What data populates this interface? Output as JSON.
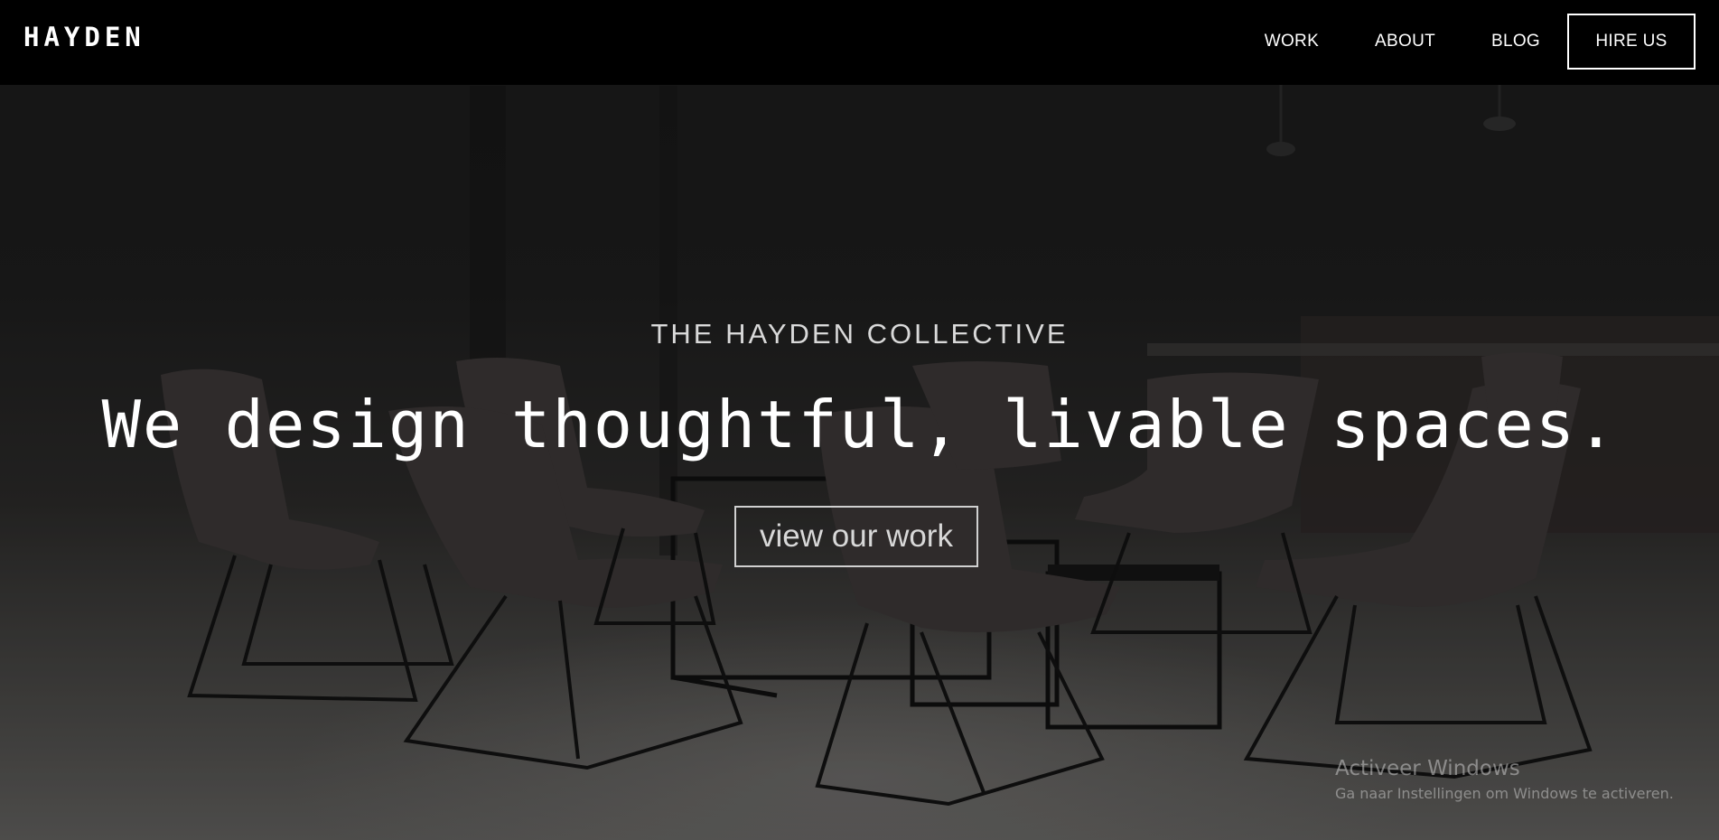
{
  "nav": {
    "brand": "HAYDEN",
    "links": [
      "WORK",
      "ABOUT",
      "BLOG"
    ],
    "hire_label": "HIRE US"
  },
  "hero": {
    "eyebrow": "THE HAYDEN COLLECTIVE",
    "headline": "We design thoughtful, livable spaces.",
    "cta_label": "view our work"
  },
  "watermark": {
    "title": "Activeer Windows",
    "subtitle": "Ga naar Instellingen om Windows te activeren."
  },
  "colors": {
    "navbar_bg": "#000000",
    "text": "#ffffff",
    "overlay": "rgba(0,0,0,0.18)"
  }
}
